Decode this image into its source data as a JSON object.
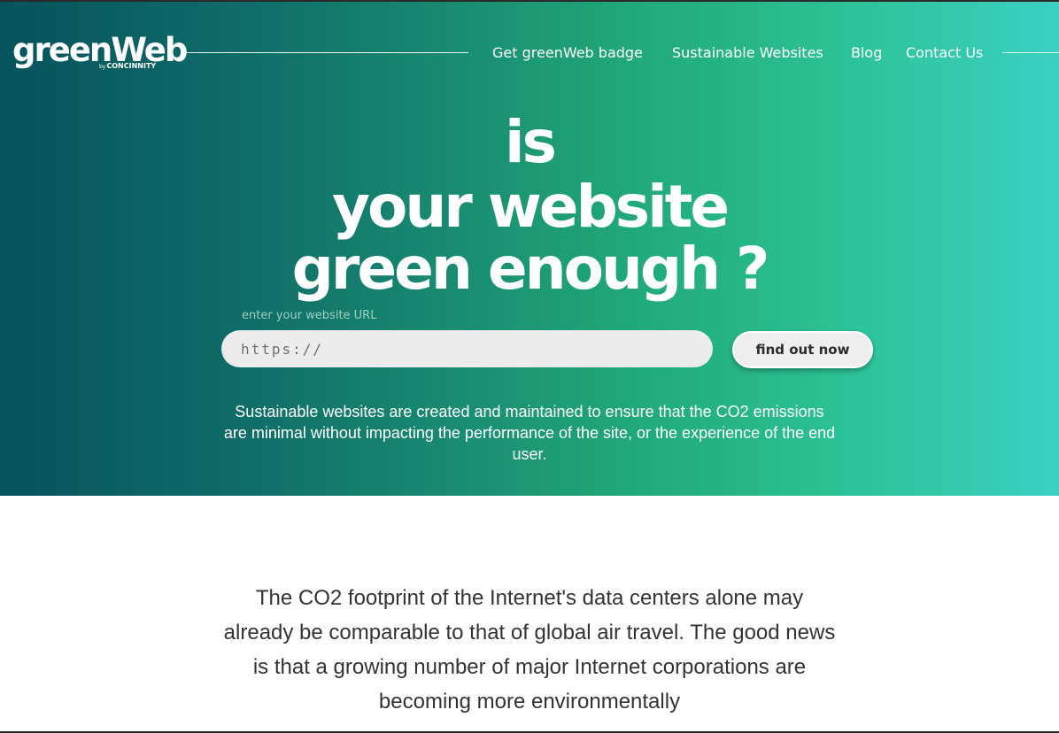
{
  "logo": {
    "name": "greenWeb",
    "sub_by": "by",
    "sub_brand": "CONCINNITY"
  },
  "nav": {
    "items": [
      {
        "label": "Get greenWeb badge"
      },
      {
        "label": "Sustainable Websites"
      },
      {
        "label": "Blog"
      },
      {
        "label": "Contact Us"
      }
    ]
  },
  "hero": {
    "headline_line1": "is",
    "headline_line2": "your website",
    "headline_line3": "green enough ?",
    "url_label": "enter your website URL",
    "url_placeholder": "https://",
    "find_button": "find out now",
    "description": "Sustainable websites are created and maintained to ensure that the CO2 emissions are minimal without impacting the performance of the site, or the experience of the end user."
  },
  "content": {
    "paragraph": "The CO2 footprint of the Internet's data centers alone may already be comparable to that of global air travel. The good news is that a growing number of major Internet corporations are becoming more environmentally"
  },
  "colors": {
    "gradient_start": "#06535c",
    "gradient_end": "#3bd0c2",
    "text_on_hero": "#ffffff",
    "body_text": "#333333"
  }
}
